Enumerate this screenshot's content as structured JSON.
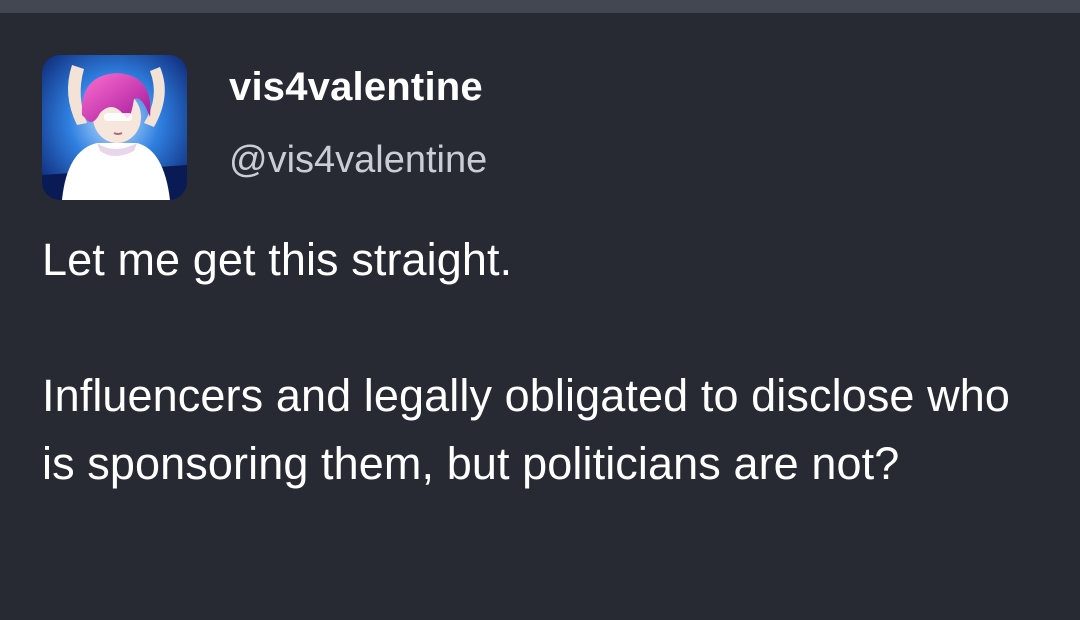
{
  "tweet": {
    "display_name": "vis4valentine",
    "handle": "@vis4valentine",
    "avatar_icon": "anime-avatar",
    "paragraphs": [
      "Let me get this straight.",
      "Influencers and legally obligated to disclose who is sponsoring them, but politicians are not?"
    ]
  },
  "colors": {
    "background": "#282a33",
    "top_bar": "#424752",
    "text": "#ffffff",
    "handle": "#c9cdd6"
  }
}
